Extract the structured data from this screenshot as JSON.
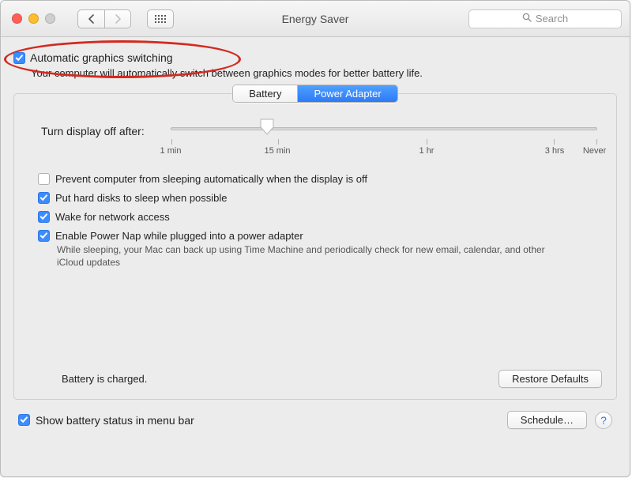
{
  "window": {
    "title": "Energy Saver"
  },
  "search": {
    "placeholder": "Search"
  },
  "auto_switch": {
    "label": "Automatic graphics switching",
    "description": "Your computer will automatically switch between graphics modes for better battery life.",
    "checked": true
  },
  "tabs": {
    "battery": "Battery",
    "power_adapter": "Power Adapter",
    "selected": "power_adapter"
  },
  "slider": {
    "label": "Turn display off after:",
    "ticks": [
      "1 min",
      "15 min",
      "1 hr",
      "3 hrs",
      "Never"
    ],
    "value_position_percent": 21
  },
  "options": {
    "prevent_sleep": {
      "label": "Prevent computer from sleeping automatically when the display is off",
      "checked": false
    },
    "hard_disks": {
      "label": "Put hard disks to sleep when possible",
      "checked": true
    },
    "wake_network": {
      "label": "Wake for network access",
      "checked": true
    },
    "power_nap": {
      "label": "Enable Power Nap while plugged into a power adapter",
      "checked": true,
      "sub": "While sleeping, your Mac can back up using Time Machine and periodically check for new email, calendar, and other iCloud updates"
    }
  },
  "status": "Battery is charged.",
  "buttons": {
    "restore_defaults": "Restore Defaults",
    "schedule": "Schedule…",
    "help": "?"
  },
  "footer": {
    "show_battery_status": {
      "label": "Show battery status in menu bar",
      "checked": true
    }
  }
}
